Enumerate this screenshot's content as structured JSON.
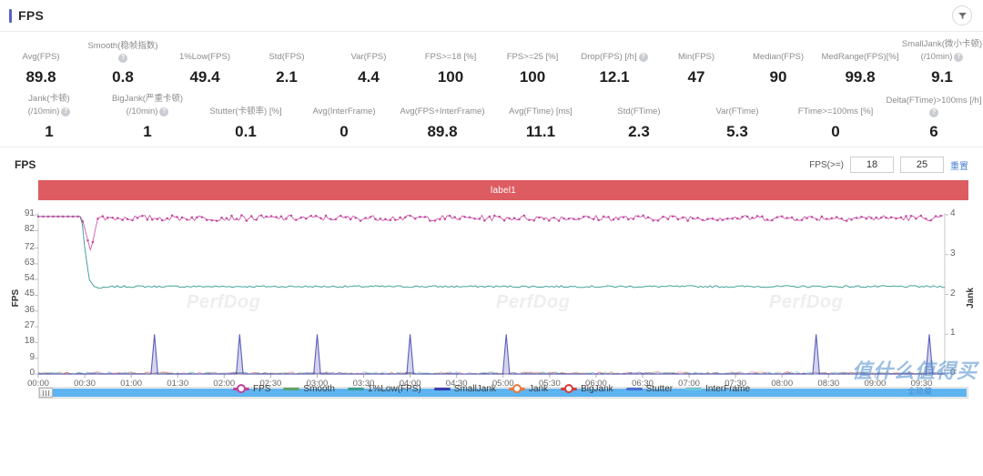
{
  "header": {
    "title": "FPS",
    "filter_icon": "funnel-icon",
    "accent_color": "#5b5fc7"
  },
  "stats": {
    "row1": [
      {
        "label": "Avg(FPS)",
        "value": "89.8",
        "help": false
      },
      {
        "label": "Smooth(稳帧指数)",
        "value": "0.8",
        "help": true
      },
      {
        "label": "1%Low(FPS)",
        "value": "49.4",
        "help": false
      },
      {
        "label": "Std(FPS)",
        "value": "2.1",
        "help": false
      },
      {
        "label": "Var(FPS)",
        "value": "4.4",
        "help": false
      },
      {
        "label": "FPS>=18 [%]",
        "value": "100",
        "help": false
      },
      {
        "label": "FPS>=25 [%]",
        "value": "100",
        "help": false
      },
      {
        "label": "Drop(FPS) [/h]",
        "value": "12.1",
        "help": true
      },
      {
        "label": "Min(FPS)",
        "value": "47",
        "help": false
      },
      {
        "label": "Median(FPS)",
        "value": "90",
        "help": false
      },
      {
        "label": "MedRange(FPS)[%]",
        "value": "99.8",
        "help": false
      },
      {
        "label": "SmallJank(微小卡顿)",
        "label2": "(/10min)",
        "value": "9.1",
        "help": true
      }
    ],
    "row2": [
      {
        "label": "Jank(卡顿)",
        "label2": "(/10min)",
        "value": "1",
        "help": true
      },
      {
        "label": "BigJank(严重卡顿)",
        "label2": "(/10min)",
        "value": "1",
        "help": true
      },
      {
        "label": "Stutter(卡顿率) [%]",
        "value": "0.1",
        "help": false
      },
      {
        "label": "Avg(InterFrame)",
        "value": "0",
        "help": false
      },
      {
        "label": "Avg(FPS+InterFrame)",
        "value": "89.8",
        "help": false
      },
      {
        "label": "Avg(FTime) [ms]",
        "value": "11.1",
        "help": false
      },
      {
        "label": "Std(FTime)",
        "value": "2.3",
        "help": false
      },
      {
        "label": "Var(FTime)",
        "value": "5.3",
        "help": false
      },
      {
        "label": "FTime>=100ms [%]",
        "value": "0",
        "help": false
      },
      {
        "label": "Delta(FTime)>100ms [/h]",
        "value": "6",
        "help": true
      }
    ]
  },
  "chart_header": {
    "title": "FPS",
    "threshold_label": "FPS(>=)",
    "threshold_low": "18",
    "threshold_high": "25",
    "reset_label": "重置"
  },
  "label_bar": {
    "text": "label1",
    "color": "#dd5c62"
  },
  "scrollbar": {
    "handle_icon": "grip-handle-icon",
    "track_color": "#5eb4f0"
  },
  "watermarks": {
    "plot": "PerfDog",
    "brand": "值什么值得买",
    "brand_sub": "全隐藏"
  },
  "legend": [
    {
      "label": "FPS",
      "color": "#c23f9c",
      "style": "dotted"
    },
    {
      "label": "Smooth",
      "color": "#5aa469",
      "style": "line"
    },
    {
      "label": "1%Low(FPS)",
      "color": "#3a9e95",
      "style": "line"
    },
    {
      "label": "SmallJank",
      "color": "#3b3bb0",
      "style": "line"
    },
    {
      "label": "Jank",
      "color": "#e8783c",
      "style": "dotted"
    },
    {
      "label": "BigJank",
      "color": "#d63b3b",
      "style": "dotted"
    },
    {
      "label": "Stutter",
      "color": "#4a6fd4",
      "style": "line"
    },
    {
      "label": "InterFrame",
      "color": "#6ec6d8",
      "style": "line"
    }
  ],
  "chart_data": {
    "type": "line",
    "title": "FPS",
    "xlabel": "",
    "ylabel": "FPS",
    "y2label": "Jank",
    "ylim": [
      0,
      91
    ],
    "y2lim": [
      0,
      4
    ],
    "grid": false,
    "legend_position": "bottom",
    "yticks": [
      0,
      9,
      18,
      27,
      36,
      45,
      54,
      63,
      72,
      82,
      91
    ],
    "y2ticks": [
      0,
      1,
      2,
      3,
      4
    ],
    "xticks": [
      "00:00",
      "00:30",
      "01:00",
      "01:30",
      "02:00",
      "02:30",
      "03:00",
      "03:30",
      "04:00",
      "04:30",
      "05:00",
      "05:30",
      "06:00",
      "06:30",
      "07:00",
      "07:30",
      "08:00",
      "08:30",
      "09:00",
      "09:30"
    ],
    "x_unit": "mm:ss",
    "series": [
      {
        "name": "FPS",
        "axis": "left",
        "color": "#c23f9c",
        "description": "Dense scatter/line oscillating between 86 and 91, average 89.8, with a brief dip to ~70 near 00:30",
        "x": [
          0,
          10,
          20,
          30,
          32,
          34,
          36,
          40,
          60,
          90,
          120,
          150,
          180,
          210,
          240,
          270,
          300,
          330,
          360,
          390,
          420,
          450,
          480,
          510,
          540,
          570
        ],
        "values": [
          90,
          90,
          90,
          90,
          78,
          84,
          88,
          89,
          90,
          89,
          90,
          89,
          90,
          89,
          90,
          90,
          89,
          90,
          89,
          90,
          90,
          89,
          90,
          89,
          90,
          89
        ]
      },
      {
        "name": "1%Low(FPS)",
        "axis": "left",
        "color": "#3a9e95",
        "description": "Starts at ~90, drops sharply at 00:30 to ~49 then settles flat around 49-50",
        "x": [
          0,
          10,
          20,
          28,
          30,
          33,
          36,
          40,
          50,
          60,
          90,
          120,
          180,
          240,
          300,
          360,
          420,
          480,
          540,
          570
        ],
        "values": [
          90,
          90,
          90,
          90,
          72,
          54,
          50,
          49,
          50,
          50,
          50,
          50,
          50,
          50,
          50,
          50,
          50,
          50,
          50,
          50
        ]
      },
      {
        "name": "SmallJank",
        "axis": "right",
        "color": "#3b3bb0",
        "description": "Baseline 0 with isolated spikes to 1",
        "spike_times": [
          "01:15",
          "02:10",
          "03:00",
          "04:00",
          "05:02",
          "08:22",
          "09:35"
        ],
        "spike_value": 1
      },
      {
        "name": "Smooth",
        "axis": "left",
        "color": "#5aa469",
        "description": "Flat near 0 along the baseline",
        "values": [
          0
        ]
      },
      {
        "name": "Jank",
        "axis": "right",
        "color": "#e8783c",
        "description": "Flat near 0 along the baseline",
        "values": [
          0
        ]
      },
      {
        "name": "BigJank",
        "axis": "right",
        "color": "#d63b3b",
        "description": "Flat near 0 along the baseline",
        "values": [
          0
        ]
      },
      {
        "name": "Stutter",
        "axis": "right",
        "color": "#4a6fd4",
        "description": "Flat near 0 along the baseline",
        "values": [
          0
        ]
      },
      {
        "name": "InterFrame",
        "axis": "left",
        "color": "#6ec6d8",
        "description": "Flat near 0 along the baseline",
        "values": [
          0
        ]
      }
    ]
  }
}
